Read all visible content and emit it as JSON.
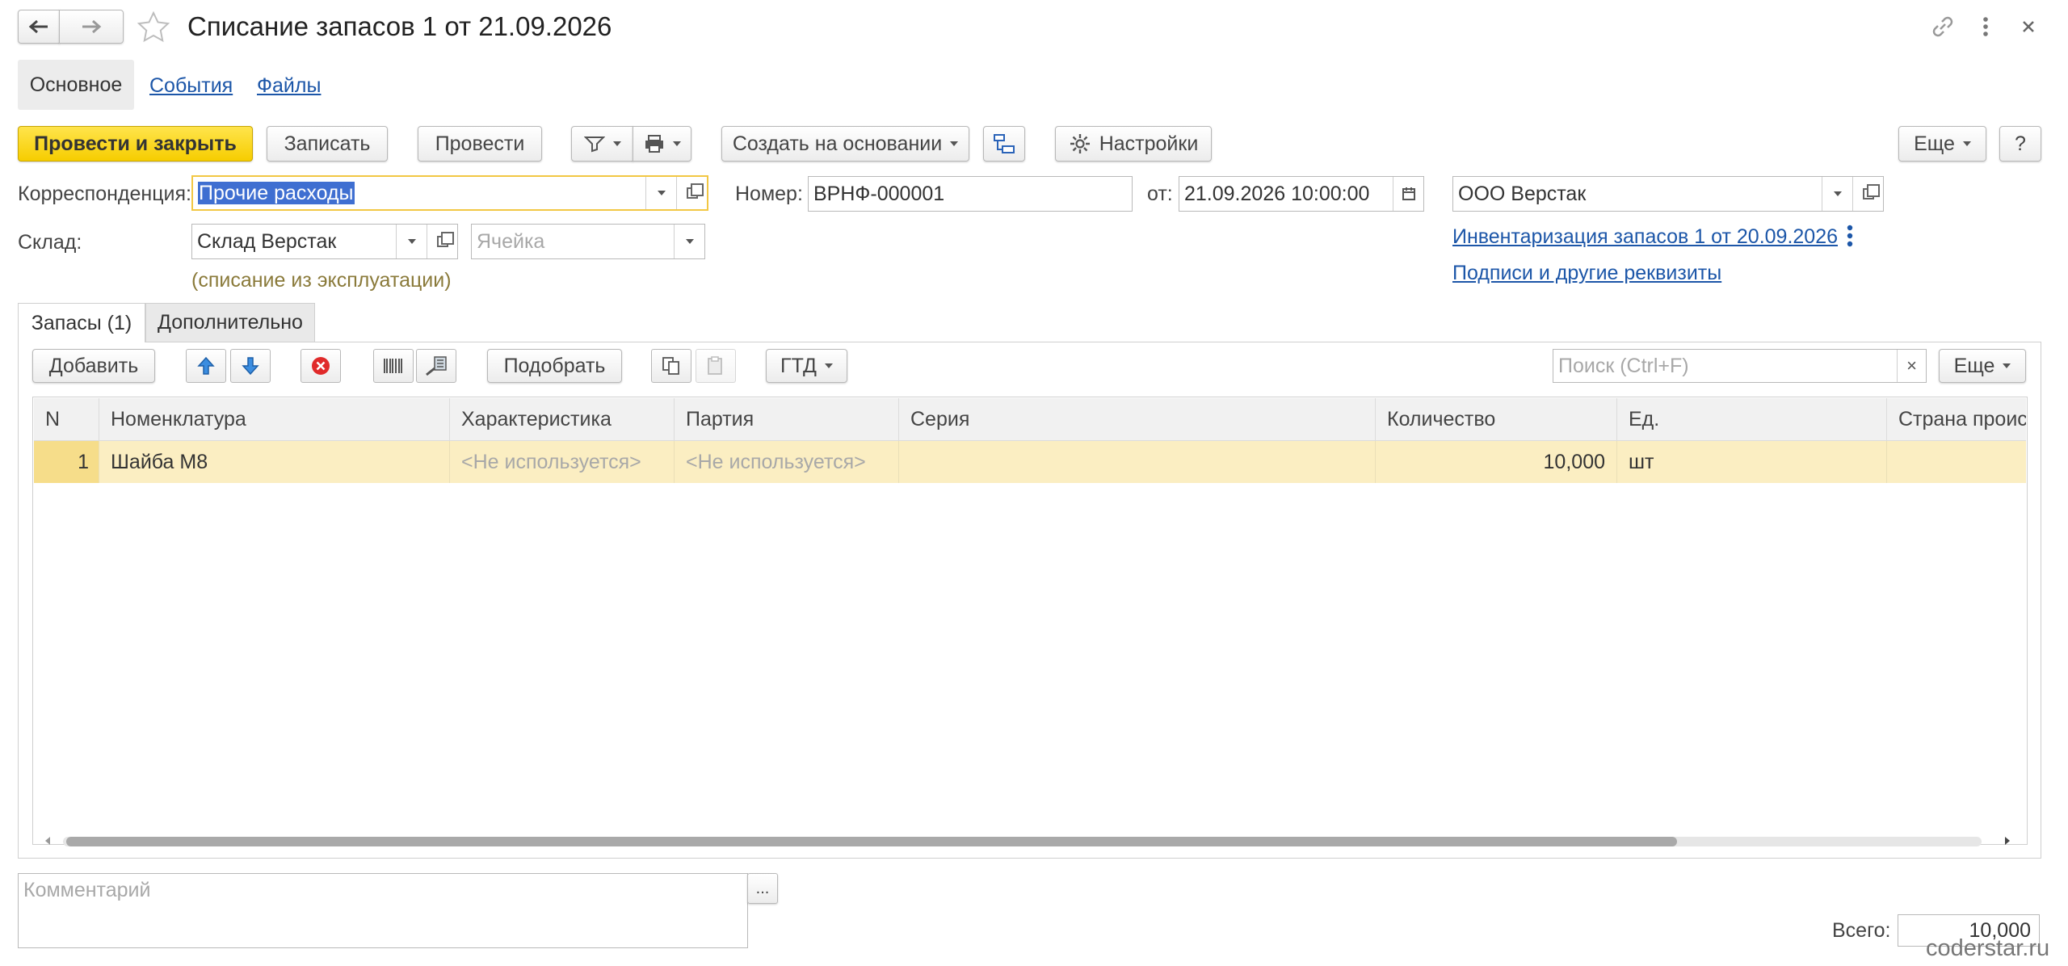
{
  "window": {
    "title": "Списание запасов 1 от 21.09.2026",
    "watermark": "coderstar.ru"
  },
  "tabs_top": [
    "Основное",
    "События",
    "Файлы"
  ],
  "toolbar": {
    "post_close": "Провести и закрыть",
    "save": "Записать",
    "post": "Провести",
    "create_based": "Создать на основании",
    "settings": "Настройки",
    "more": "Еще",
    "help": "?"
  },
  "form": {
    "corr_label": "Корреспонденция:",
    "corr_value": "Прочие расходы",
    "number_label": "Номер:",
    "number_value": "ВРНФ-000001",
    "date_label": "от:",
    "date_value": "21.09.2026 10:00:00",
    "org_value": "ООО Верстак",
    "warehouse_label": "Склад:",
    "warehouse_value": "Склад Верстак",
    "cell_placeholder": "Ячейка",
    "note": "(списание из эксплуатации)",
    "link_inventory": "Инвентаризация запасов 1 от 20.09.2026",
    "link_signatures": "Подписи и другие реквизиты"
  },
  "inner_tabs": [
    "Запасы (1)",
    "Дополнительно"
  ],
  "table_toolbar": {
    "add": "Добавить",
    "pick": "Подобрать",
    "gtd": "ГТД",
    "search_placeholder": "Поиск (Ctrl+F)",
    "clear": "×",
    "more": "Еще"
  },
  "table": {
    "columns": [
      "N",
      "Номенклатура",
      "Характеристика",
      "Партия",
      "Серия",
      "Количество",
      "Ед.",
      "Страна происх"
    ],
    "rows": [
      [
        "1",
        "Шайба М8",
        "<Не используется>",
        "<Не используется>",
        "",
        "10,000",
        "шт",
        ""
      ]
    ]
  },
  "footer": {
    "comment_placeholder": "Комментарий",
    "ellipsis": "...",
    "total_label": "Всего:",
    "total_value": "10,000"
  },
  "colors": {
    "primary_button": "#f6cd00",
    "link": "#1c56a8",
    "selection": "#3f6fd1",
    "row_highlight": "#fbeec2",
    "note_text": "#8a7a3a"
  }
}
